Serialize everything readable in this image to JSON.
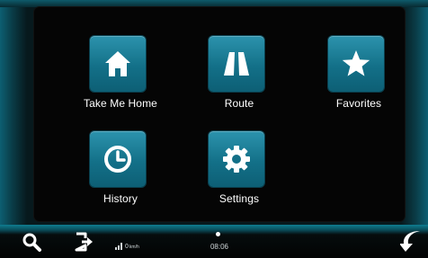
{
  "menu": {
    "tiles": [
      {
        "label": "Take Me Home",
        "icon": "house-icon"
      },
      {
        "label": "Route",
        "icon": "road-icon"
      },
      {
        "label": "Favorites",
        "icon": "star-icon"
      },
      {
        "label": "History",
        "icon": "clock-icon"
      },
      {
        "label": "Settings",
        "icon": "gear-icon"
      }
    ]
  },
  "status_bar": {
    "speed_value": "0",
    "speed_unit": "km/h",
    "signal_icon": "signal-bars-icon",
    "time": "08:06",
    "icons": [
      "search-icon",
      "exit-icon",
      "back-arrow-icon"
    ]
  },
  "colors": {
    "tile_accent": "#137088",
    "panel": "#050505",
    "text": "#ffffff"
  }
}
